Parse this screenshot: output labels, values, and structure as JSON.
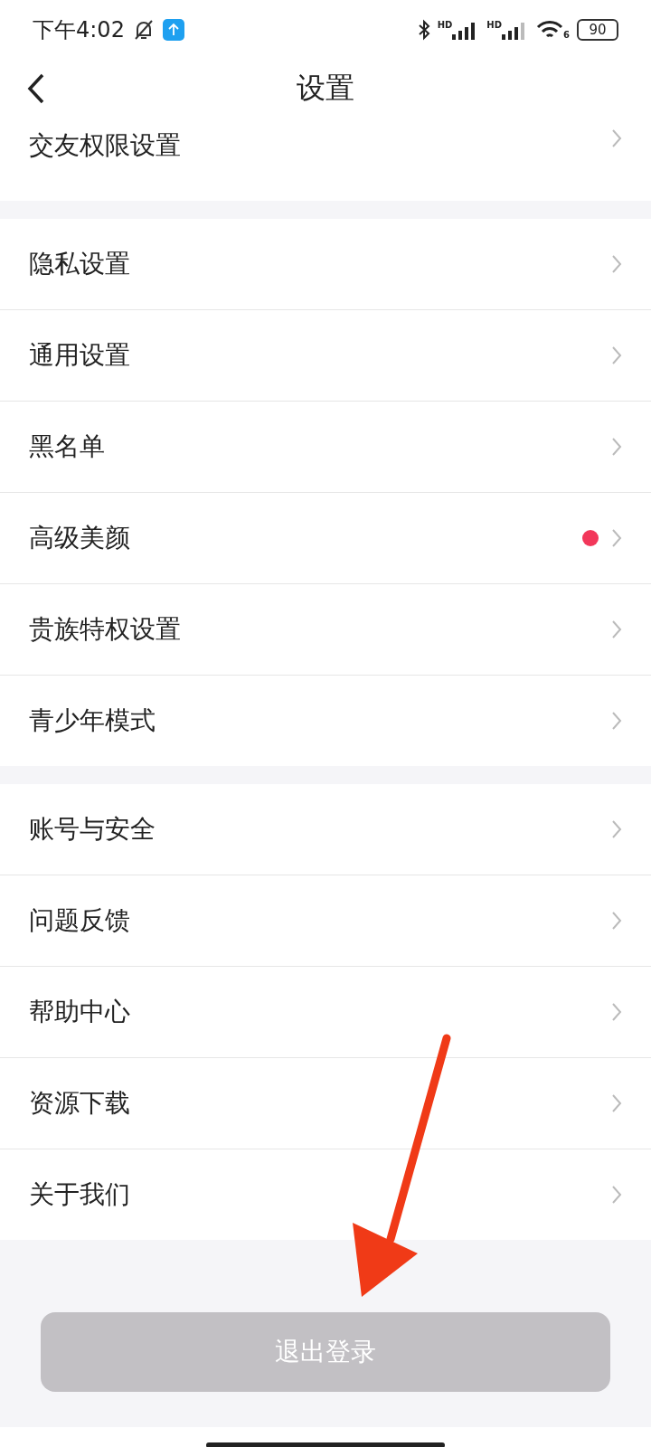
{
  "status_bar": {
    "time": "下午4:02",
    "sim1": "HD",
    "sim2": "HD",
    "wifi_label": "6",
    "battery": "90"
  },
  "header": {
    "title": "设置"
  },
  "groups": [
    {
      "items": [
        {
          "label": "交友权限设置",
          "dot": false
        }
      ]
    },
    {
      "items": [
        {
          "label": "隐私设置",
          "dot": false
        },
        {
          "label": "通用设置",
          "dot": false
        },
        {
          "label": "黑名单",
          "dot": false
        },
        {
          "label": "高级美颜",
          "dot": true
        },
        {
          "label": "贵族特权设置",
          "dot": false
        },
        {
          "label": "青少年模式",
          "dot": false
        }
      ]
    },
    {
      "items": [
        {
          "label": "账号与安全",
          "dot": false
        },
        {
          "label": "问题反馈",
          "dot": false
        },
        {
          "label": "帮助中心",
          "dot": false
        },
        {
          "label": "资源下载",
          "dot": false
        },
        {
          "label": "关于我们",
          "dot": false
        }
      ]
    }
  ],
  "logout_button": {
    "label": "退出登录"
  }
}
